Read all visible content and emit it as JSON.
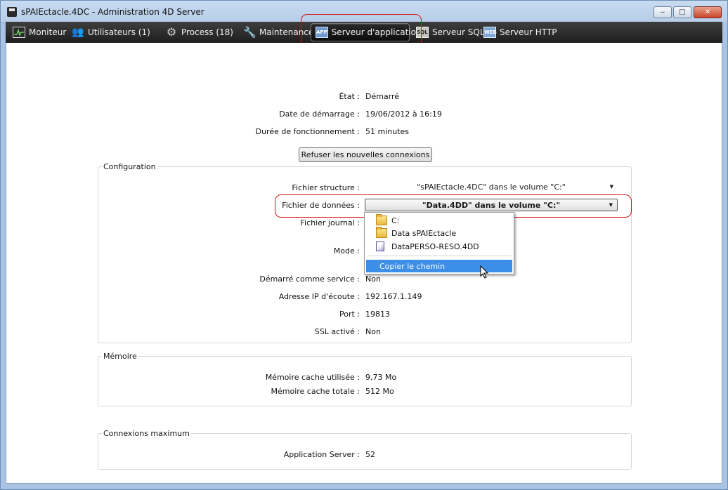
{
  "window": {
    "title": "sPAIEctacle.4DC - Administration 4D Server",
    "buttons": {
      "minimize": "‒",
      "maximize": "□",
      "close": "✕"
    }
  },
  "toolbar": {
    "items": [
      {
        "label": "Moniteur",
        "icon": "monitor-icon"
      },
      {
        "label": "Utilisateurs (1)",
        "icon": "users-icon"
      },
      {
        "label": "Process (18)",
        "icon": "gear-icon"
      },
      {
        "label": "Maintenance",
        "icon": "tools-icon"
      },
      {
        "label": "Serveur d'application",
        "icon": "app-server-icon",
        "active": true
      },
      {
        "label": "Serveur SQL",
        "icon": "sql-icon"
      },
      {
        "label": "Serveur HTTP",
        "icon": "web-icon"
      }
    ],
    "icon_text": {
      "app": "APP",
      "sql": "SQL",
      "web": "WEB"
    }
  },
  "status": {
    "state_label": "État :",
    "state_value": "Démarré",
    "start_label": "Date de démarrage :",
    "start_value": "19/06/2012 à 16:19",
    "uptime_label": "Durée de fonctionnement :",
    "uptime_value": "51 minutes",
    "refuse_button": "Refuser les nouvelles connexions"
  },
  "configuration": {
    "title": "Configuration",
    "structure_label": "Fichier structure :",
    "structure_value": "\"sPAIEctacle.4DC\" dans le volume \"C:\"",
    "data_label": "Fichier de données :",
    "data_value": "\"Data.4DD\" dans le volume \"C:\"",
    "journal_label": "Fichier journal :",
    "mode_label": "Mode :",
    "service_label": "Démarré comme service :",
    "service_value": "Non",
    "ip_label": "Adresse IP d'écoute :",
    "ip_value": "192.167.1.149",
    "port_label": "Port :",
    "port_value": "19813",
    "ssl_label": "SSL activé :",
    "ssl_value": "Non"
  },
  "dropdown_menu": {
    "items": [
      {
        "label": "C:",
        "icon": "folder-icon"
      },
      {
        "label": "Data sPAIEctacle",
        "icon": "folder-icon"
      },
      {
        "label": "DataPERSO-RESO.4DD",
        "icon": "file-icon"
      }
    ],
    "action": "Copier le chemin"
  },
  "memory": {
    "title": "Mémoire",
    "used_label": "Mémoire cache utilisée :",
    "used_value": "9,73 Mo",
    "total_label": "Mémoire cache totale :",
    "total_value": "512 Mo"
  },
  "connections": {
    "title": "Connexions maximum",
    "app_label": "Application Server :",
    "app_value": "52"
  },
  "colors": {
    "toolbar_bg": "#1e1e1e",
    "highlight": "#d41414",
    "menu_selection": "#3d8ee6"
  }
}
